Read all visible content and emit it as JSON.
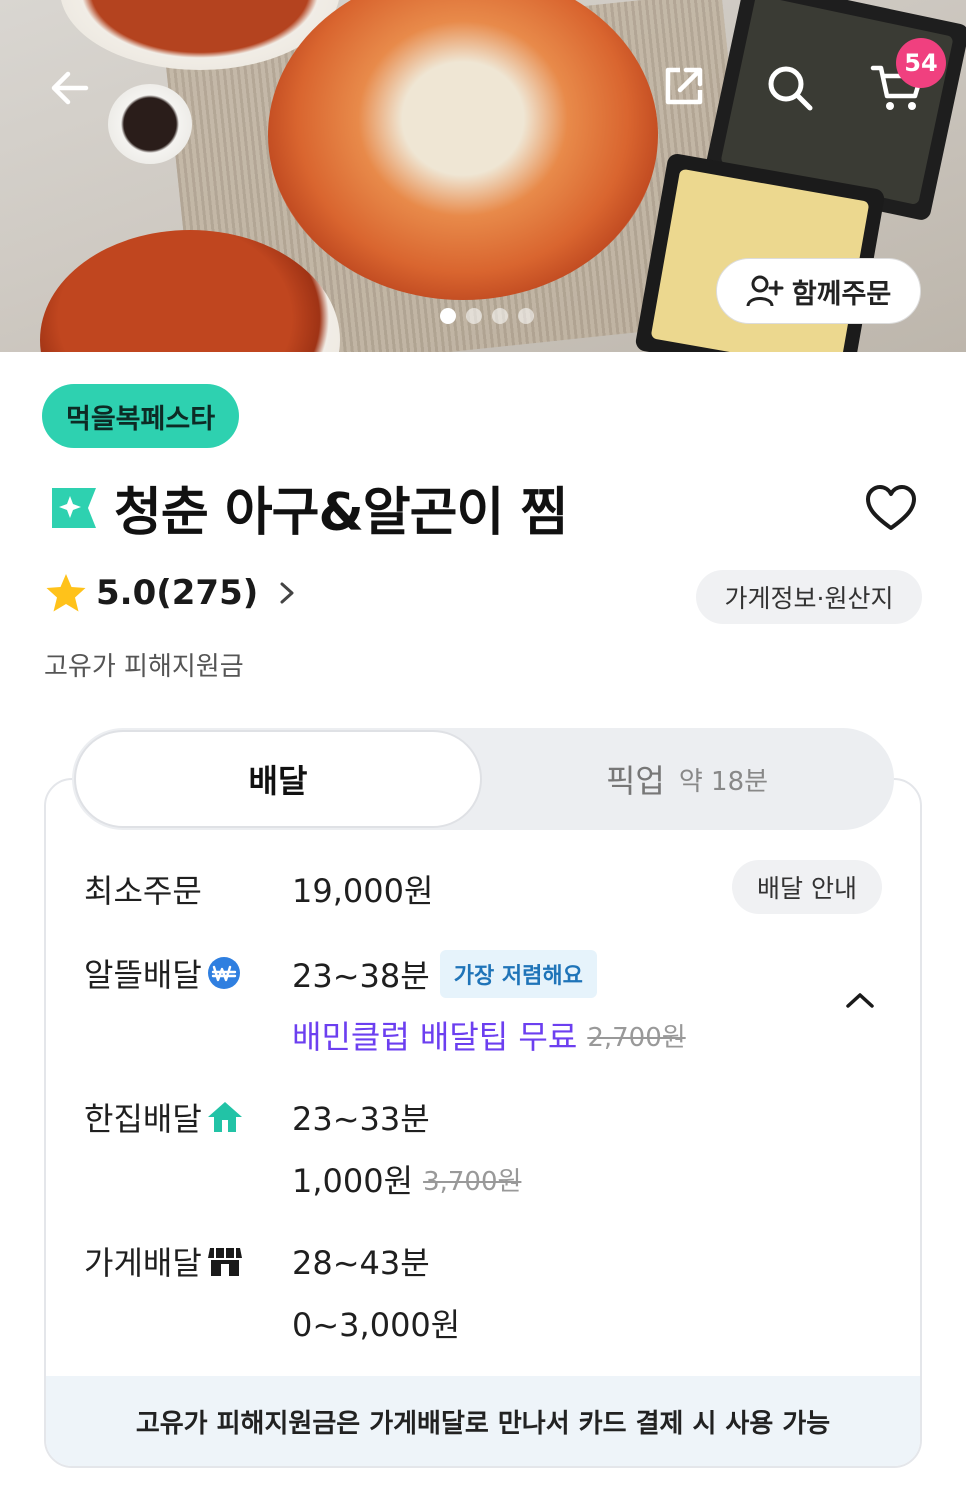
{
  "header": {
    "cart_count": "54",
    "together_order_label": "함께주문",
    "carousel": {
      "total": 4,
      "active": 1
    }
  },
  "store": {
    "promo_badge": "먹을복페스타",
    "name": "청춘 아구&알곤이 찜",
    "rating": "5.0(275)",
    "info_chip": "가게정보·원산지",
    "subsidy": "고유가 피해지원금"
  },
  "tabs": {
    "delivery": "배달",
    "pickup": "픽업",
    "pickup_time": "약 18분"
  },
  "delivery": {
    "min_order_label": "최소주문",
    "min_order_value": "19,000원",
    "guide_chip": "배달 안내",
    "options": [
      {
        "label": "알뜰배달",
        "time": "23~38분",
        "badge": "가장 저렴해요",
        "fee": "배민클럽 배달팁 무료",
        "fee_original": "2,700원"
      },
      {
        "label": "한집배달",
        "time": "23~33분",
        "fee": "1,000원",
        "fee_original": "3,700원"
      },
      {
        "label": "가게배달",
        "time": "28~43분",
        "fee": "0~3,000원"
      }
    ],
    "footer_notice": "고유가 피해지원금은 가게배달로 만나서 카드 결제 시 사용 가능"
  },
  "colors": {
    "accent_mint": "#2ed1b0",
    "badge_pink": "#f0407f",
    "club_purple": "#6c3ff0",
    "cheap_blue": "#1f74b8"
  },
  "icons": [
    "back-arrow-icon",
    "share-icon",
    "search-icon",
    "cart-icon",
    "add-user-icon",
    "store-star-icon",
    "heart-icon",
    "star-icon",
    "chevron-right-icon",
    "won-coin-icon",
    "home-icon",
    "shop-icon",
    "chevron-up-icon"
  ]
}
